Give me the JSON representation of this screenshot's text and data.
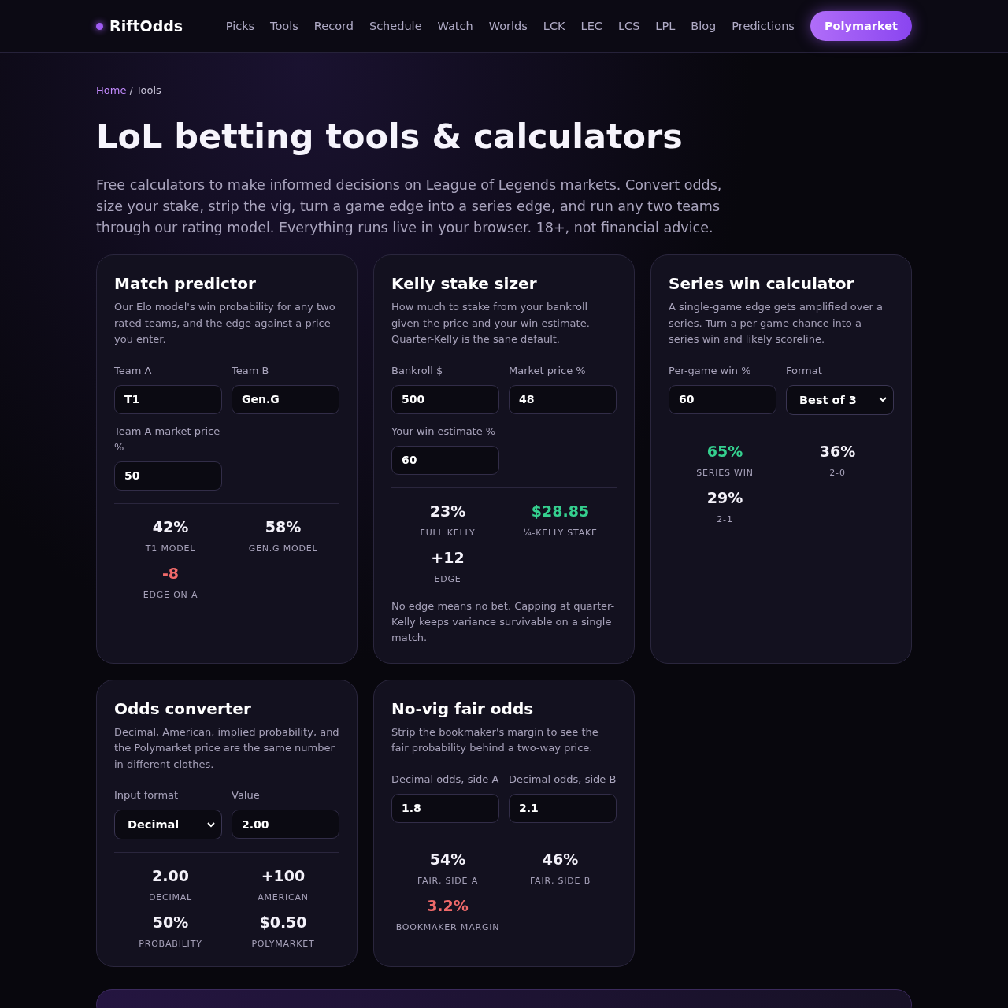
{
  "header": {
    "logo": "RiftOdds",
    "nav": [
      {
        "label": "Picks"
      },
      {
        "label": "Tools"
      },
      {
        "label": "Record"
      },
      {
        "label": "Schedule"
      },
      {
        "label": "Watch"
      },
      {
        "label": "Worlds"
      },
      {
        "label": "LCK"
      },
      {
        "label": "LEC"
      },
      {
        "label": "LCS"
      },
      {
        "label": "LPL"
      },
      {
        "label": "Blog"
      },
      {
        "label": "Predictions"
      }
    ],
    "cta": "Polymarket"
  },
  "breadcrumb": {
    "home": "Home",
    "separator": "/",
    "current": "Tools"
  },
  "title": "LoL betting tools & calculators",
  "intro": "Free calculators to make informed decisions on League of Legends markets. Convert odds, size your stake, strip the vig, turn a game edge into a series edge, and run any two teams through our rating model. Everything runs live in your browser. 18+, not financial advice.",
  "cards": [
    {
      "title": "Match predictor",
      "description": "Our Elo model's win probability for any two rated teams, and the edge against a price you enter.",
      "fields": [
        {
          "kind": "input",
          "label": "Team A",
          "value": "T1"
        },
        {
          "kind": "input",
          "label": "Team B",
          "value": "Gen.G"
        },
        {
          "kind": "input",
          "label": "Team A market price %",
          "value": "50"
        }
      ],
      "stats": [
        {
          "value": "42%",
          "label": "T1 MODEL",
          "color": "#f4f2fa"
        },
        {
          "value": "58%",
          "label": "GEN.G MODEL",
          "color": "#f4f2fa"
        },
        {
          "value": "-8",
          "label": "EDGE ON A",
          "color": "#f06a6a"
        }
      ]
    },
    {
      "title": "Kelly stake sizer",
      "description": "How much to stake from your bankroll given the price and your win estimate. Quarter-Kelly is the sane default.",
      "fields": [
        {
          "kind": "input",
          "label": "Bankroll $",
          "value": "500"
        },
        {
          "kind": "input",
          "label": "Market price %",
          "value": "48"
        },
        {
          "kind": "input",
          "label": "Your win estimate %",
          "value": "60"
        }
      ],
      "stats": [
        {
          "value": "23%",
          "label": "FULL KELLY",
          "color": "#f4f2fa"
        },
        {
          "value": "$28.85",
          "label": "¼-KELLY STAKE",
          "color": "#35d08f"
        },
        {
          "value": "+12",
          "label": "EDGE",
          "color": "#f4f2fa"
        }
      ],
      "note": "No edge means no bet. Capping at quarter-Kelly keeps variance survivable on a single match."
    },
    {
      "title": "Series win calculator",
      "description": "A single-game edge gets amplified over a series. Turn a per-game chance into a series win and likely scoreline.",
      "fields": [
        {
          "kind": "input",
          "label": "Per-game win %",
          "value": "60"
        },
        {
          "kind": "select",
          "label": "Format",
          "value": "Best of 3"
        }
      ],
      "stats": [
        {
          "value": "65%",
          "label": "SERIES WIN",
          "color": "#35d08f"
        },
        {
          "value": "36%",
          "label": "2-0",
          "color": "#f4f2fa"
        },
        {
          "value": "29%",
          "label": "2-1",
          "color": "#f4f2fa"
        }
      ]
    },
    {
      "title": "Odds converter",
      "description": "Decimal, American, implied probability, and the Polymarket price are the same number in different clothes.",
      "fields": [
        {
          "kind": "select",
          "label": "Input format",
          "value": "Decimal"
        },
        {
          "kind": "input",
          "label": "Value",
          "value": "2.00"
        }
      ],
      "stats": [
        {
          "value": "2.00",
          "label": "DECIMAL",
          "color": "#f4f2fa"
        },
        {
          "value": "+100",
          "label": "AMERICAN",
          "color": "#f4f2fa"
        },
        {
          "value": "50%",
          "label": "PROBABILITY",
          "color": "#f4f2fa"
        },
        {
          "value": "$0.50",
          "label": "POLYMARKET",
          "color": "#f4f2fa"
        }
      ]
    },
    {
      "title": "No-vig fair odds",
      "description": "Strip the bookmaker's margin to see the fair probability behind a two-way price.",
      "fields": [
        {
          "kind": "input",
          "label": "Decimal odds, side A",
          "value": "1.8"
        },
        {
          "kind": "input",
          "label": "Decimal odds, side B",
          "value": "2.1"
        }
      ],
      "stats": [
        {
          "value": "54%",
          "label": "FAIR, SIDE A",
          "color": "#f4f2fa"
        },
        {
          "value": "46%",
          "label": "FAIR, SIDE B",
          "color": "#f4f2fa"
        },
        {
          "value": "3.2%",
          "label": "BOOKMAKER MARGIN",
          "color": "#f06a6a"
        }
      ]
    }
  ]
}
